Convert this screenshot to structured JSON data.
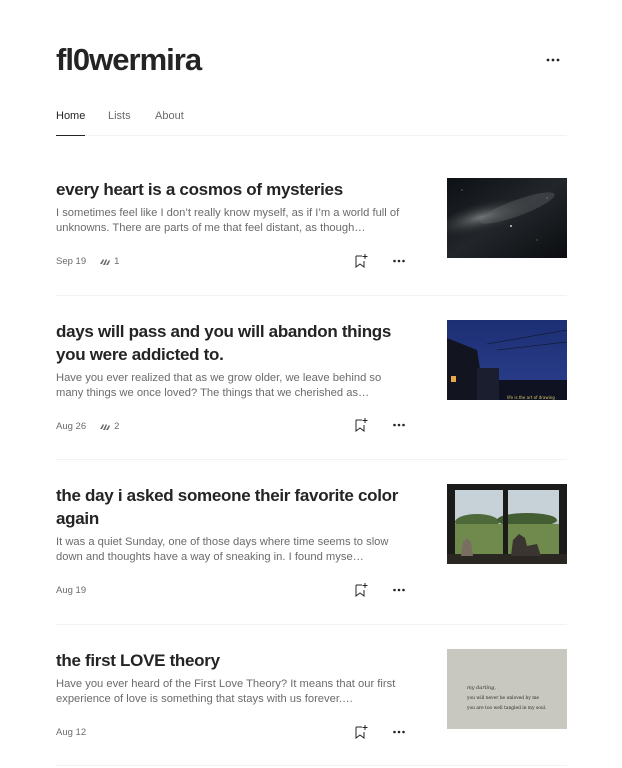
{
  "blog": {
    "title": "fl0wermira"
  },
  "tabs": [
    {
      "label": "Home"
    },
    {
      "label": "Lists"
    },
    {
      "label": "About"
    }
  ],
  "posts": [
    {
      "title": "every heart is a cosmos of mysteries",
      "excerpt": "I sometimes feel like I don’t really know myself, as if I’m a world full of unknowns. There are parts of me that feel distant, as though…",
      "date": "Sep 19",
      "claps": "1",
      "thumbnail": "night-sky"
    },
    {
      "title": "days will pass and you will abandon things you were addicted to.",
      "excerpt": "Have you ever realized that as we grow older, we leave behind so many things we once loved? The things that we cherished as…",
      "date": "Aug 26",
      "claps": "2",
      "thumbnail": "evening-street",
      "thumbnail_caption": "life is the art of drawing"
    },
    {
      "title": "the day i asked someone their favorite color again",
      "excerpt": "It was a quiet Sunday, one of those days where time seems to slow down and thoughts have a way of sneaking in. I found myse…",
      "date": "Aug 19",
      "claps": "",
      "thumbnail": "cats-at-window"
    },
    {
      "title": "the first LOVE theory",
      "excerpt": "Have you ever heard of the First Love Theory? It means that our first experience of love is something that stays with us forever.…",
      "date": "Aug 12",
      "claps": "",
      "thumbnail": "handwritten-note",
      "thumbnail_text": [
        "my darling,",
        "you will never be unloved by me",
        "you are too well tangled in my soul."
      ]
    }
  ],
  "icons": {
    "header_more": "more-horizontal-icon",
    "clap": "clap-icon",
    "bookmark": "bookmark-add-icon",
    "post_more": "more-horizontal-icon"
  },
  "colors": {
    "text_primary": "#242424",
    "text_secondary": "#6b6b6b",
    "divider": "#f2f2f2"
  }
}
